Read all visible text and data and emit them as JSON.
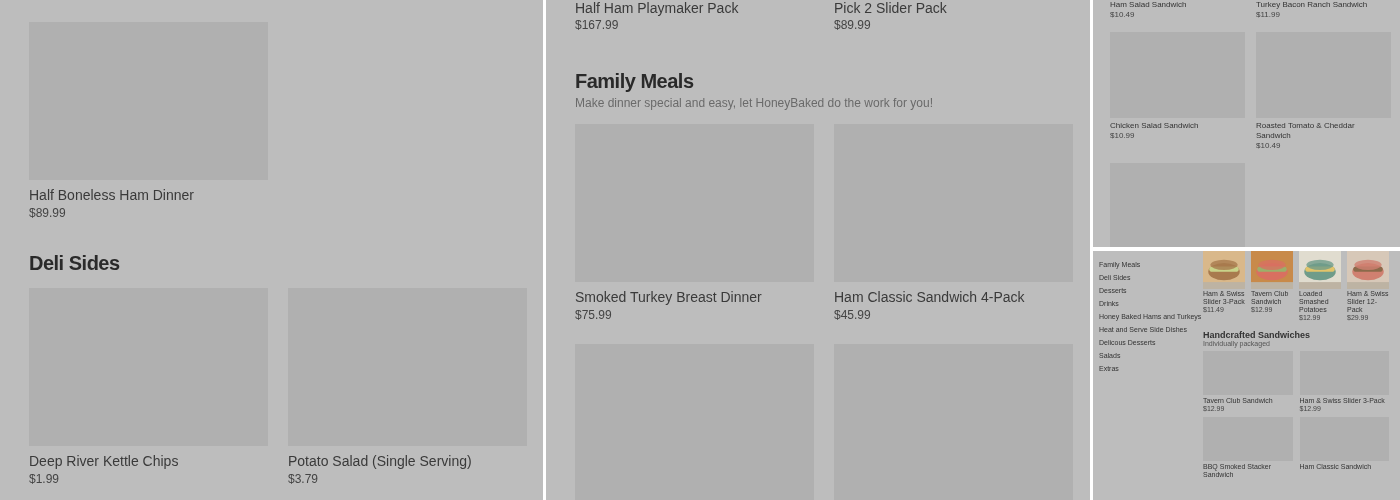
{
  "left_page": {
    "items": [
      {
        "name": "Half Boneless Ham Dinner",
        "price": "$89.99"
      }
    ],
    "section": {
      "title": "Deli Sides",
      "items": [
        {
          "name": "Deep River Kettle Chips",
          "price": "$1.99"
        },
        {
          "name": "Potato Salad (Single Serving)",
          "price": "$3.79"
        }
      ]
    }
  },
  "middle_page": {
    "top_items": [
      {
        "name": "Half Ham Playmaker Pack",
        "price": "$167.99"
      },
      {
        "name": "Pick 2 Slider Pack",
        "price": "$89.99"
      }
    ],
    "section": {
      "title": "Family Meals",
      "subtitle": "Make dinner special and easy, let HoneyBaked do the work for you!",
      "items": [
        {
          "name": "Smoked Turkey Breast Dinner",
          "price": "$75.99"
        },
        {
          "name": "Ham Classic Sandwich 4-Pack",
          "price": "$45.99"
        }
      ]
    }
  },
  "sandwich_page": {
    "items": [
      {
        "name": "Ham Salad Sandwich",
        "price": "$10.49",
        "kind": "text"
      },
      {
        "name": "Turkey Bacon Ranch Sandwich",
        "price": "$11.99",
        "kind": "text"
      },
      {
        "name": "Chicken Salad Sandwich",
        "price": "$10.99",
        "kind": "card"
      },
      {
        "name": "Roasted Tomato & Cheddar Sandwich",
        "price": "$10.49",
        "kind": "card"
      }
    ]
  },
  "menu_page": {
    "sidebar": {
      "items": [
        "Family Meals",
        "Deli Sides",
        "Desserts",
        "Drinks",
        "Honey Baked Hams and Turkeys",
        "Heat and Serve Side Dishes",
        "Delicous Desserts",
        "Salads",
        "Extras"
      ]
    },
    "featured": [
      {
        "name": "Ham & Swiss Slider 3-Pack",
        "price": "$11.49"
      },
      {
        "name": "Tavern Club Sandwich",
        "price": "$12.99"
      },
      {
        "name": "Loaded Smashed Potatoes",
        "price": "$12.99"
      },
      {
        "name": "Ham & Swiss Slider 12-Pack",
        "price": "$29.99"
      }
    ],
    "section": {
      "title": "Handcrafted Sandwiches",
      "subtitle": "Individually packaged",
      "items": [
        {
          "name": "Tavern Club Sandwich",
          "price": "$12.99"
        },
        {
          "name": "Ham & Swiss Slider 3-Pack",
          "price": "$12.99"
        },
        {
          "name": "BBQ Smoked Stacker Sandwich"
        },
        {
          "name": "Ham Classic Sandwich"
        }
      ]
    }
  }
}
